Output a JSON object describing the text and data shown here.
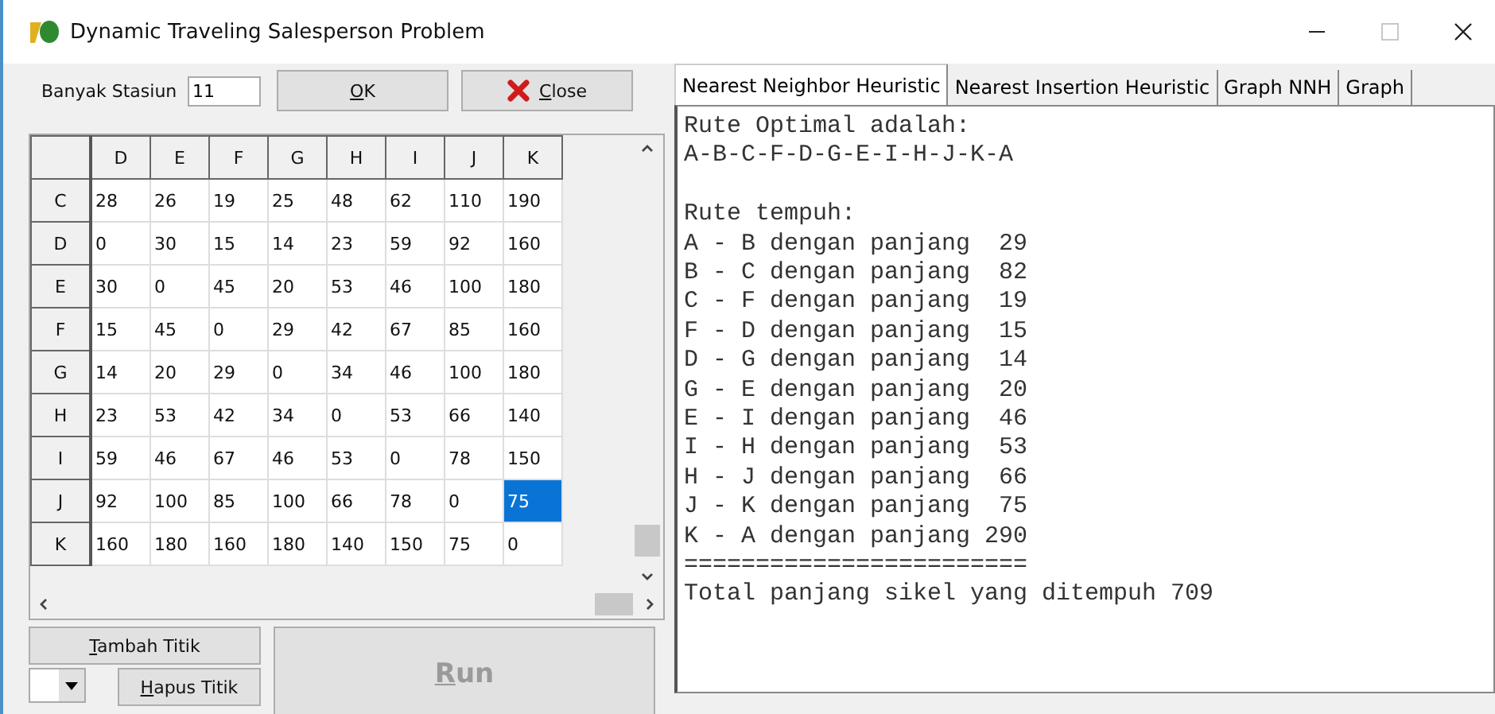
{
  "window": {
    "title": "Dynamic Traveling Salesperson Problem",
    "maximize_disabled": true
  },
  "station_count": {
    "label": "Banyak Stasiun",
    "value": "11"
  },
  "buttons": {
    "ok": "OK",
    "close": "Close",
    "add": "Tambah Titik",
    "remove": "Hapus Titik",
    "run": "Run",
    "run_disabled": true
  },
  "table": {
    "columns": [
      "D",
      "E",
      "F",
      "G",
      "H",
      "I",
      "J",
      "K"
    ],
    "rows": [
      {
        "header": "C",
        "cells": [
          {
            "value": "28",
            "selected": false
          },
          {
            "value": "26",
            "selected": false
          },
          {
            "value": "19",
            "selected": false
          },
          {
            "value": "25",
            "selected": false
          },
          {
            "value": "48",
            "selected": false
          },
          {
            "value": "62",
            "selected": false
          },
          {
            "value": "110",
            "selected": false
          },
          {
            "value": "190",
            "selected": false
          }
        ]
      },
      {
        "header": "D",
        "cells": [
          {
            "value": "0",
            "selected": false
          },
          {
            "value": "30",
            "selected": false
          },
          {
            "value": "15",
            "selected": false
          },
          {
            "value": "14",
            "selected": false
          },
          {
            "value": "23",
            "selected": false
          },
          {
            "value": "59",
            "selected": false
          },
          {
            "value": "92",
            "selected": false
          },
          {
            "value": "160",
            "selected": false
          }
        ]
      },
      {
        "header": "E",
        "cells": [
          {
            "value": "30",
            "selected": false
          },
          {
            "value": "0",
            "selected": false
          },
          {
            "value": "45",
            "selected": false
          },
          {
            "value": "20",
            "selected": false
          },
          {
            "value": "53",
            "selected": false
          },
          {
            "value": "46",
            "selected": false
          },
          {
            "value": "100",
            "selected": false
          },
          {
            "value": "180",
            "selected": false
          }
        ]
      },
      {
        "header": "F",
        "cells": [
          {
            "value": "15",
            "selected": false
          },
          {
            "value": "45",
            "selected": false
          },
          {
            "value": "0",
            "selected": false
          },
          {
            "value": "29",
            "selected": false
          },
          {
            "value": "42",
            "selected": false
          },
          {
            "value": "67",
            "selected": false
          },
          {
            "value": "85",
            "selected": false
          },
          {
            "value": "160",
            "selected": false
          }
        ]
      },
      {
        "header": "G",
        "cells": [
          {
            "value": "14",
            "selected": false
          },
          {
            "value": "20",
            "selected": false
          },
          {
            "value": "29",
            "selected": false
          },
          {
            "value": "0",
            "selected": false
          },
          {
            "value": "34",
            "selected": false
          },
          {
            "value": "46",
            "selected": false
          },
          {
            "value": "100",
            "selected": false
          },
          {
            "value": "180",
            "selected": false
          }
        ]
      },
      {
        "header": "H",
        "cells": [
          {
            "value": "23",
            "selected": false
          },
          {
            "value": "53",
            "selected": false
          },
          {
            "value": "42",
            "selected": false
          },
          {
            "value": "34",
            "selected": false
          },
          {
            "value": "0",
            "selected": false
          },
          {
            "value": "53",
            "selected": false
          },
          {
            "value": "66",
            "selected": false
          },
          {
            "value": "140",
            "selected": false
          }
        ]
      },
      {
        "header": "I",
        "cells": [
          {
            "value": "59",
            "selected": false
          },
          {
            "value": "46",
            "selected": false
          },
          {
            "value": "67",
            "selected": false
          },
          {
            "value": "46",
            "selected": false
          },
          {
            "value": "53",
            "selected": false
          },
          {
            "value": "0",
            "selected": false
          },
          {
            "value": "78",
            "selected": false
          },
          {
            "value": "150",
            "selected": false
          }
        ]
      },
      {
        "header": "J",
        "cells": [
          {
            "value": "92",
            "selected": false
          },
          {
            "value": "100",
            "selected": false
          },
          {
            "value": "85",
            "selected": false
          },
          {
            "value": "100",
            "selected": false
          },
          {
            "value": "66",
            "selected": false
          },
          {
            "value": "78",
            "selected": false
          },
          {
            "value": "0",
            "selected": false
          },
          {
            "value": "75",
            "selected": true
          }
        ]
      },
      {
        "header": "K",
        "cells": [
          {
            "value": "160",
            "selected": false
          },
          {
            "value": "180",
            "selected": false
          },
          {
            "value": "160",
            "selected": false
          },
          {
            "value": "180",
            "selected": false
          },
          {
            "value": "140",
            "selected": false
          },
          {
            "value": "150",
            "selected": false
          },
          {
            "value": "75",
            "selected": false
          },
          {
            "value": "0",
            "selected": false
          }
        ]
      }
    ]
  },
  "tabs": [
    {
      "label": "Nearest Neighbor Heuristic",
      "selected": true
    },
    {
      "label": "Nearest Insertion Heuristic",
      "selected": false
    },
    {
      "label": "Graph NNH",
      "selected": false
    },
    {
      "label": "Graph",
      "selected": false
    }
  ],
  "output": [
    {
      "lines": [
        "Rute Optimal adalah:",
        "A-B-C-F-D-G-E-I-H-J-K-A"
      ]
    },
    {
      "lines": [
        "Rute tempuh:",
        "A - B dengan panjang  29",
        "B - C dengan panjang  82",
        "C - F dengan panjang  19",
        "F - D dengan panjang  15",
        "D - G dengan panjang  14",
        "G - E dengan panjang  20",
        "E - I dengan panjang  46",
        "I - H dengan panjang  53",
        "H - J dengan panjang  66",
        "J - K dengan panjang  75",
        "K - A dengan panjang 290",
        "========================",
        "Total panjang sikel yang ditempuh 709"
      ]
    }
  ]
}
